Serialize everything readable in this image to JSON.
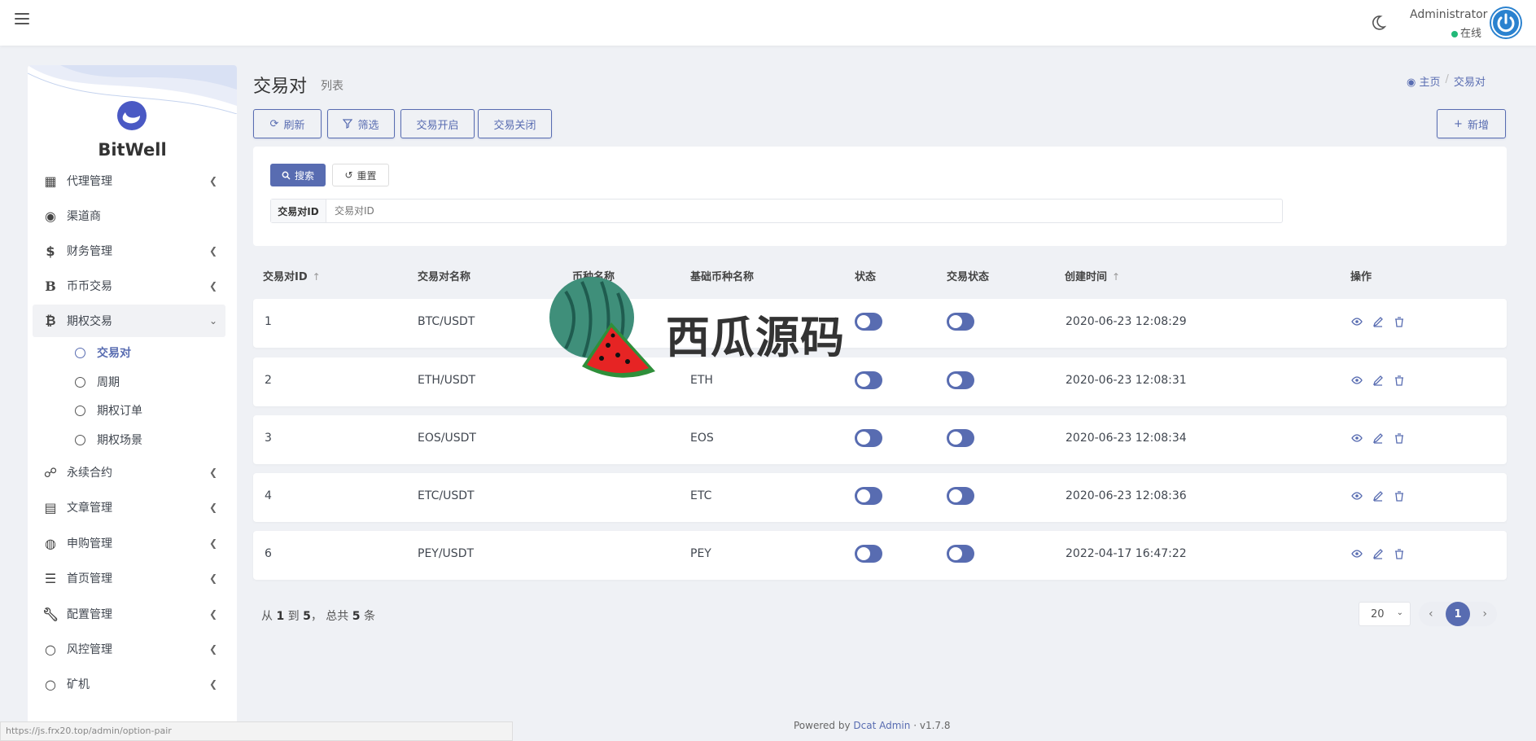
{
  "navbar": {
    "user_name": "Administrator",
    "user_status": "在线"
  },
  "sidebar": {
    "brand": "BitWell",
    "items": [
      {
        "label": "代理管理",
        "icon": "id-card-icon",
        "has_arrow": true
      },
      {
        "label": "渠道商",
        "icon": "user-circle-icon",
        "has_arrow": false
      },
      {
        "label": "财务管理",
        "icon": "dollar-icon",
        "has_arrow": true
      },
      {
        "label": "币币交易",
        "icon": "bold-b-icon",
        "has_arrow": true
      },
      {
        "label": "期权交易",
        "icon": "bitcoin-icon",
        "has_arrow": true,
        "expanded": true
      },
      {
        "label": "永续合约",
        "icon": "link-icon",
        "has_arrow": true
      },
      {
        "label": "文章管理",
        "icon": "newspaper-icon",
        "has_arrow": true
      },
      {
        "label": "申购管理",
        "icon": "life-ring-icon",
        "has_arrow": true
      },
      {
        "label": "首页管理",
        "icon": "list-icon",
        "has_arrow": true
      },
      {
        "label": "配置管理",
        "icon": "wrench-icon",
        "has_arrow": true
      },
      {
        "label": "风控管理",
        "icon": "circle-icon",
        "has_arrow": true
      },
      {
        "label": "矿机",
        "icon": "circle-icon",
        "has_arrow": true
      }
    ],
    "sub_items": [
      {
        "label": "交易对",
        "active": true
      },
      {
        "label": "周期",
        "active": false
      },
      {
        "label": "期权订单",
        "active": false
      },
      {
        "label": "期权场景",
        "active": false
      }
    ]
  },
  "header": {
    "title": "交易对",
    "subtitle": "列表",
    "breadcrumb_home": "主页",
    "breadcrumb_sep": "/",
    "breadcrumb_current": "交易对"
  },
  "toolbar": {
    "refresh": "刷新",
    "filter": "筛选",
    "open_trade": "交易开启",
    "close_trade": "交易关闭",
    "add": "新增"
  },
  "filter": {
    "search": "搜索",
    "reset": "重置",
    "label": "交易对ID",
    "placeholder": "交易对ID"
  },
  "table": {
    "headers": [
      "交易对ID",
      "交易对名称",
      "币种名称",
      "基础币种名称",
      "状态",
      "交易状态",
      "创建时间",
      "操作"
    ],
    "rows": [
      {
        "id": "1",
        "name": "BTC/USDT",
        "currency": "",
        "base": "",
        "status_on": true,
        "trade_on": true,
        "created": "2020-06-23 12:08:29"
      },
      {
        "id": "2",
        "name": "ETH/USDT",
        "currency": "",
        "base": "ETH",
        "status_on": true,
        "trade_on": true,
        "created": "2020-06-23 12:08:31"
      },
      {
        "id": "3",
        "name": "EOS/USDT",
        "currency": "",
        "base": "EOS",
        "status_on": true,
        "trade_on": true,
        "created": "2020-06-23 12:08:34"
      },
      {
        "id": "4",
        "name": "ETC/USDT",
        "currency": "",
        "base": "ETC",
        "status_on": true,
        "trade_on": true,
        "created": "2020-06-23 12:08:36"
      },
      {
        "id": "6",
        "name": "PEY/USDT",
        "currency": "",
        "base": "PEY",
        "status_on": true,
        "trade_on": true,
        "created": "2022-04-17 16:47:22"
      }
    ]
  },
  "pagination": {
    "prefix": "从",
    "from": "1",
    "to_word": "到",
    "to": "5",
    "total_word": "， 总共",
    "total": "5",
    "unit": "条",
    "page_size": "20",
    "current_page": "1"
  },
  "footer": {
    "powered_by": "Powered by",
    "brand": "Dcat Admin",
    "sep": "·",
    "version": "v1.7.8",
    "status_url": "https://js.frx20.top/admin/option-pair"
  },
  "watermark": {
    "text": "西瓜源码"
  },
  "colors": {
    "primary": "#586cb1",
    "online": "#21b978",
    "background": "#eff1f5"
  }
}
